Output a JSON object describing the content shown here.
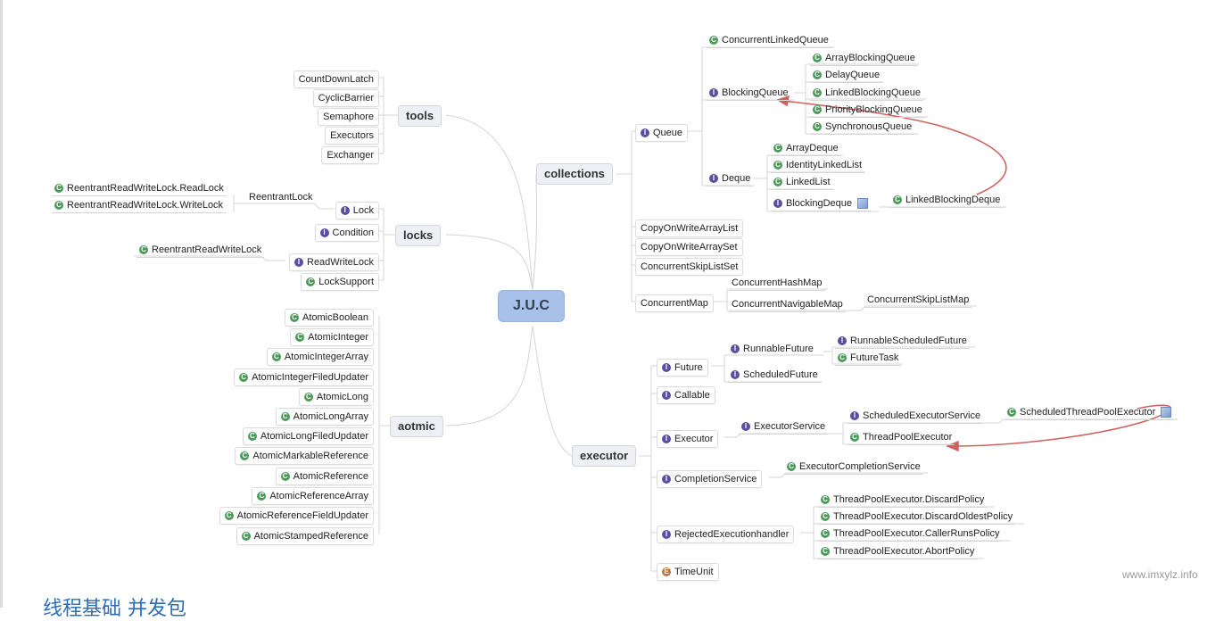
{
  "root": "J.U.C",
  "watermark": "www.imxylz.info",
  "footer_title": "线程基础 并发包",
  "icon_legend": {
    "c": "class-icon",
    "i": "interface-icon",
    "e": "enum-icon"
  },
  "accent_colors": {
    "root": "#a8c1e8",
    "arrow": "#d06060",
    "class": "#4c9a5a",
    "interface": "#5b4f9e",
    "enum": "#b87a3d"
  },
  "branches": {
    "tools": {
      "label": "tools",
      "items": [
        "CountDownLatch",
        "CyclicBarrier",
        "Semaphore",
        "Executors",
        "Exchanger"
      ]
    },
    "locks": {
      "label": "locks",
      "lock": "Lock",
      "reentrant_lock": "ReentrantLock",
      "read_lock": "ReentrantReadWriteLock.ReadLock",
      "write_lock": "ReentrantReadWriteLock.WriteLock",
      "condition": "Condition",
      "read_write_lock": "ReadWriteLock",
      "reentrant_rw_lock": "ReentrantReadWriteLock",
      "lock_support": "LockSupport"
    },
    "atomic": {
      "label": "aotmic",
      "items": [
        "AtomicBoolean",
        "AtomicInteger",
        "AtomicIntegerArray",
        "AtomicIntegerFiledUpdater",
        "AtomicLong",
        "AtomicLongArray",
        "AtomicLongFiledUpdater",
        "AtomicMarkableReference",
        "AtomicReference",
        "AtomicReferenceArray",
        "AtomicReferenceFieldUpdater",
        "AtomicStampedReference"
      ]
    },
    "collections": {
      "label": "collections",
      "queue": "Queue",
      "concurrent_linked_queue": "ConcurrentLinkedQueue",
      "blocking_queue": "BlockingQueue",
      "blocking_queue_impls": [
        "ArrayBlockingQueue",
        "DelayQueue",
        "LinkedBlockingQueue",
        "PriorityBlockingQueue",
        "SynchronousQueue"
      ],
      "deque": "Deque",
      "deque_impls": [
        "ArrayDeque",
        "IdentityLinkedList",
        "LinkedList"
      ],
      "blocking_deque": "BlockingDeque",
      "linked_blocking_deque": "LinkedBlockingDeque",
      "others": [
        "CopyOnWriteArrayList",
        "CopyOnWriteArraySet",
        "ConcurrentSkipListSet"
      ],
      "concurrent_map": "ConcurrentMap",
      "concurrent_hash_map": "ConcurrentHashMap",
      "concurrent_navigable_map": "ConcurrentNavigableMap",
      "concurrent_skip_list_map": "ConcurrentSkipListMap"
    },
    "executor": {
      "label": "executor",
      "future": "Future",
      "runnable_future": "RunnableFuture",
      "runnable_scheduled_future": "RunnableScheduledFuture",
      "future_task": "FutureTask",
      "scheduled_future": "ScheduledFuture",
      "callable": "Callable",
      "executor": "Executor",
      "executor_service": "ExecutorService",
      "scheduled_executor_service": "ScheduledExecutorService",
      "scheduled_thread_pool_executor": "ScheduledThreadPoolExecutor",
      "thread_pool_executor": "ThreadPoolExecutor",
      "completion_service": "CompletionService",
      "executor_completion_service": "ExecutorCompletionService",
      "rejected_handler": "RejectedExecutionhandler",
      "policies": [
        "ThreadPoolExecutor.DiscardPolicy",
        "ThreadPoolExecutor.DiscardOldestPolicy",
        "ThreadPoolExecutor.CallerRunsPolicy",
        "ThreadPoolExecutor.AbortPolicy"
      ],
      "time_unit": "TimeUnit"
    }
  }
}
